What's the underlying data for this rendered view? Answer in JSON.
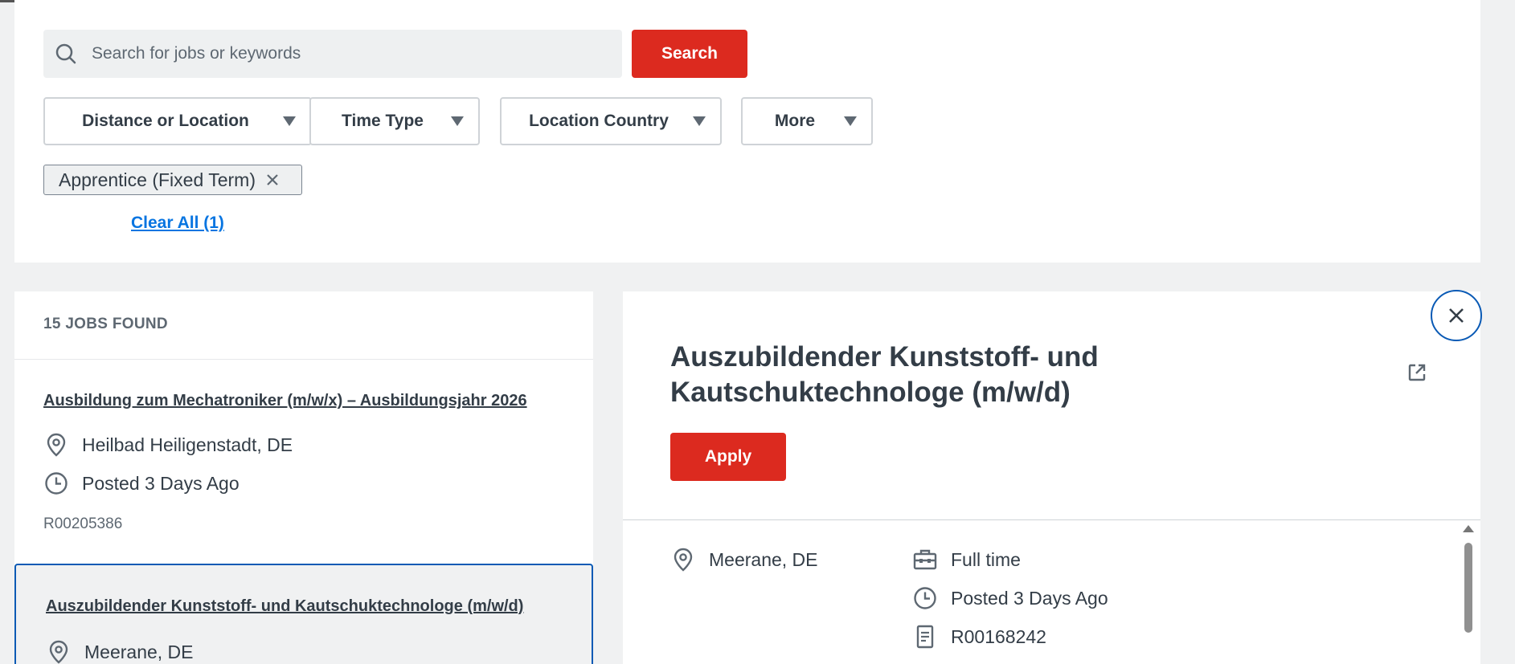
{
  "search": {
    "placeholder": "Search for jobs or keywords",
    "button_label": "Search"
  },
  "filters": [
    {
      "label": "Distance or Location"
    },
    {
      "label": "Time Type"
    },
    {
      "label": "Location Country"
    },
    {
      "label": "More"
    }
  ],
  "active_filters": {
    "chips": [
      {
        "label": "Apprentice (Fixed Term)"
      }
    ],
    "clear_all_label": "Clear All (1)"
  },
  "results": {
    "count_label": "15 JOBS FOUND",
    "jobs": [
      {
        "title": "Ausbildung zum Mechatroniker (m/w/x) – Ausbildungsjahr 2026",
        "location": "Heilbad Heiligenstadt, DE",
        "posted": "Posted 3 Days Ago",
        "req_id": "R00205386"
      },
      {
        "title": "Auszubildender Kunststoff- und Kautschuktechnologe (m/w/d)",
        "location": "Meerane, DE"
      }
    ]
  },
  "detail": {
    "title": "Auszubildender Kunststoff- und Kautschuktechnologe (m/w/d)",
    "apply_label": "Apply",
    "location": "Meerane, DE",
    "time_type": "Full time",
    "posted": "Posted 3 Days Ago",
    "req_id": "R00168242"
  },
  "colors": {
    "accent_red": "#dc2a1f",
    "link_blue": "#0875e1",
    "selected_border": "#0a5ab5"
  },
  "icons": {
    "search": "search-icon",
    "remove": "close-icon",
    "location": "location-pin-icon",
    "clock": "clock-icon",
    "briefcase": "briefcase-icon",
    "document": "document-icon",
    "external": "external-link-icon",
    "close": "close-icon"
  }
}
